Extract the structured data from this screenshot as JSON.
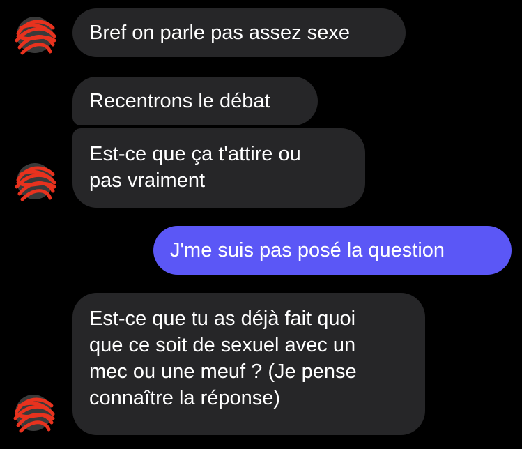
{
  "colors": {
    "background": "#000000",
    "incoming_bubble": "#262628",
    "outgoing_bubble": "#5b57f6",
    "text": "#ffffff",
    "avatar_scribble": "#e8321e"
  },
  "messages": [
    {
      "sender": "them",
      "text": "Bref on parle pas assez sexe"
    },
    {
      "sender": "them",
      "text": "Recentrons le débat"
    },
    {
      "sender": "them",
      "text": "Est-ce que ça t'attire ou\npas vraiment"
    },
    {
      "sender": "me",
      "text": "J'me suis pas posé la question"
    },
    {
      "sender": "them",
      "text": "Est-ce que tu as déjà fait quoi\nque ce soit de sexuel avec un\nmec ou une meuf ? (Je pense\nconnaître la réponse)"
    }
  ],
  "avatars": [
    {
      "icon": "redacted-avatar-scribble"
    },
    {
      "icon": "redacted-avatar-scribble"
    },
    {
      "icon": "redacted-avatar-scribble"
    }
  ]
}
